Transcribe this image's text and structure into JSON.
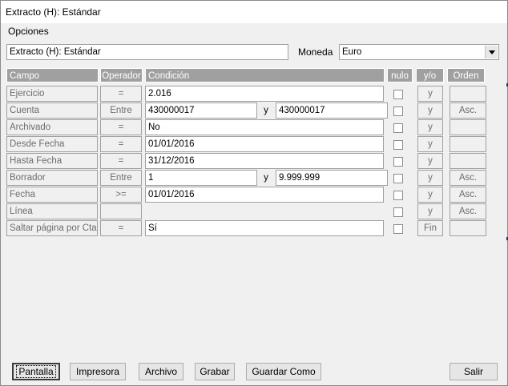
{
  "window": {
    "title": "Extracto (H): Estándar"
  },
  "menu": {
    "label": "Opciones"
  },
  "header": {
    "report_name": "Extracto (H): Estándar",
    "currency_label": "Moneda",
    "currency_value": "Euro"
  },
  "columns": {
    "campo": "Campo",
    "operador": "Operador",
    "condicion": "Condición",
    "nulo": "nulo",
    "yo": "y/o",
    "orden": "Orden"
  },
  "rows": [
    {
      "campo": "Ejercicio",
      "operador": "=",
      "cond1": "2.016",
      "sep": "",
      "cond2": "",
      "yo": "y",
      "orden": ""
    },
    {
      "campo": "Cuenta",
      "operador": "Entre",
      "cond1": "430000017",
      "sep": "y",
      "cond2": "430000017",
      "yo": "y",
      "orden": "Asc."
    },
    {
      "campo": "Archivado",
      "operador": "=",
      "cond1": "No",
      "sep": "",
      "cond2": "",
      "yo": "y",
      "orden": ""
    },
    {
      "campo": "Desde Fecha",
      "operador": "=",
      "cond1": "01/01/2016",
      "sep": "",
      "cond2": "",
      "yo": "y",
      "orden": ""
    },
    {
      "campo": "Hasta Fecha",
      "operador": "=",
      "cond1": "31/12/2016",
      "sep": "",
      "cond2": "",
      "yo": "y",
      "orden": ""
    },
    {
      "campo": "Borrador",
      "operador": "Entre",
      "cond1": "1",
      "sep": "y",
      "cond2": "9.999.999",
      "yo": "y",
      "orden": "Asc."
    },
    {
      "campo": "Fecha",
      "operador": ">=",
      "cond1": "01/01/2016",
      "sep": "",
      "cond2": "",
      "yo": "y",
      "orden": "Asc."
    },
    {
      "campo": "Línea",
      "operador": "",
      "cond1": "",
      "sep": "",
      "cond2": "",
      "yo": "y",
      "orden": "Asc."
    },
    {
      "campo": "Saltar página por Cta.",
      "operador": "=",
      "cond1": "Sí",
      "sep": "",
      "cond2": "",
      "yo": "Fin",
      "orden": ""
    }
  ],
  "buttons": {
    "pantalla": "Pantalla",
    "impresora": "Impresora",
    "archivo": "Archivo",
    "grabar": "Grabar",
    "guardar_como": "Guardar Como",
    "salir": "Salir"
  },
  "icons": {
    "dropdown": "chevron-down-icon"
  }
}
